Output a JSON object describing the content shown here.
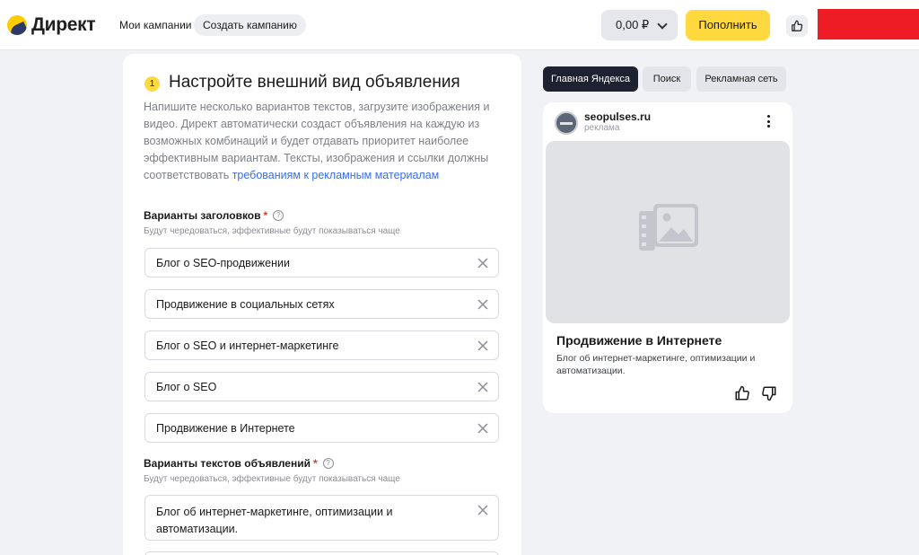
{
  "header": {
    "logo_text": "Директ",
    "nav_campaigns": "Мои кампании",
    "nav_create": "Создать кампанию",
    "balance": "0,00 ₽",
    "topup": "Пополнить"
  },
  "form": {
    "step_number": "1",
    "title": "Настройте внешний вид объявления",
    "description": "Напишите несколько вариантов текстов, загрузите изображения и видео. Директ автоматически создаст объявления на каждую из возможных комбинаций и будет отдавать приоритет наиболее эффективным вариантам. Тексты, изображения и ссылки должны соответствовать ",
    "description_link": "требованиям к рекламным материалам",
    "headlines_label": "Варианты заголовков",
    "headlines_hint": "Будут чередоваться, эффективные будут показываться чаще",
    "headlines": [
      "Блог о SEO-продвижении",
      "Продвижение в социальных сетях",
      "Блог о SEO и интернет-маркетинге",
      "Блог о SEO",
      "Продвижение в Интернете"
    ],
    "texts_label": "Варианты текстов объявлений",
    "texts_hint": "Будут чередоваться, эффективные будут показываться чаще",
    "texts": [
      "Блог об интернет-маркетинге, оптимизации и автоматизации."
    ],
    "required_mark": "*",
    "help_mark": "?"
  },
  "preview_tabs": [
    {
      "label": "Главная Яндекса",
      "active": true
    },
    {
      "label": "Поиск",
      "active": false
    },
    {
      "label": "Рекламная сеть",
      "active": false
    }
  ],
  "preview": {
    "site": "seopulses.ru",
    "ad_label": "реклама",
    "title": "Продвижение в Интернете",
    "text": "Блог об интернет-маркетинге, оптимизации и автоматизации."
  },
  "colors": {
    "accent_yellow": "#ffd93d",
    "active_tab": "#1d2130",
    "link": "#3a6ee8",
    "required": "#e8342a",
    "redacted_block": "#ee1c25"
  }
}
